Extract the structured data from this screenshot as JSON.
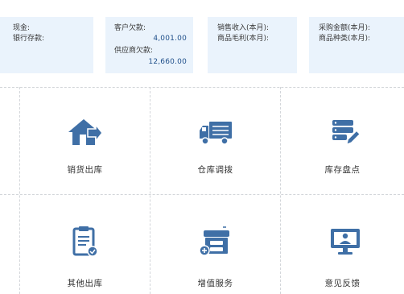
{
  "summary": {
    "cash": {
      "label": "现金:",
      "value": ""
    },
    "bank": {
      "label": "银行存款:",
      "value": ""
    },
    "receivable": {
      "label": "客户欠款:",
      "value": "4,001.00"
    },
    "payable": {
      "label": "供应商欠款:",
      "value": "12,660.00"
    },
    "sales_income": {
      "label": "销售收入(本月):",
      "value": ""
    },
    "gross_profit": {
      "label": "商品毛利(本月):",
      "value": ""
    },
    "purchase_amount": {
      "label": "采购金额(本月):",
      "value": ""
    },
    "product_kinds": {
      "label": "商品种类(本月):",
      "value": ""
    }
  },
  "tiles": [
    {
      "label": "销货出库",
      "icon": "house-arrow-icon"
    },
    {
      "label": "仓库调拨",
      "icon": "truck-icon"
    },
    {
      "label": "库存盘点",
      "icon": "stack-pencil-icon"
    },
    {
      "label": "其他出库",
      "icon": "clipboard-icon"
    },
    {
      "label": "增值服务",
      "icon": "cabinet-plus-icon"
    },
    {
      "label": "意见反馈",
      "icon": "monitor-user-icon"
    }
  ],
  "colors": {
    "accent": "#3f6fa6",
    "card_bg": "#eaf3fc",
    "value_text": "#1f4f8a"
  }
}
